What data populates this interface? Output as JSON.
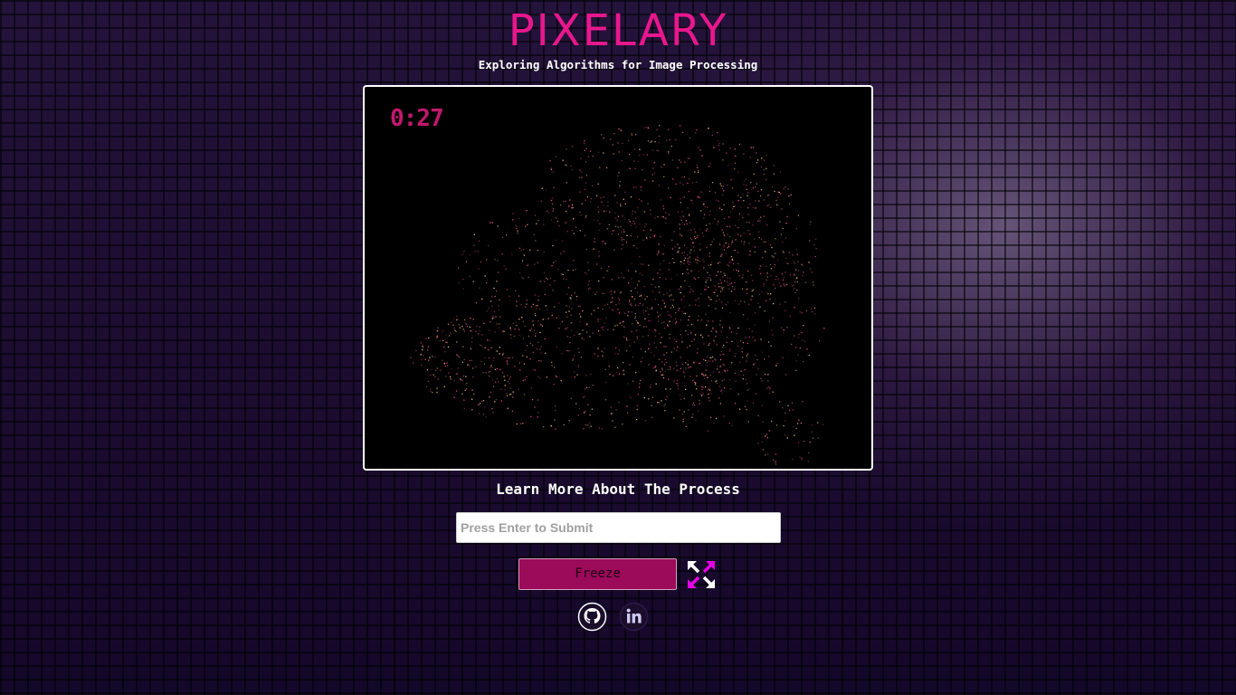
{
  "header": {
    "title": "PIXELARY",
    "subtitle": "Exploring Algorithms for Image Processing"
  },
  "canvas": {
    "timer": "0:27"
  },
  "learn_more": {
    "label": "Learn More About The Process"
  },
  "input": {
    "placeholder": "Press Enter to Submit",
    "value": ""
  },
  "controls": {
    "freeze_label": "Freeze",
    "expand_icon": "expand-arrows-icon"
  },
  "social": {
    "github_icon": "github-icon",
    "linkedin_icon": "linkedin-icon"
  },
  "colors": {
    "accent": "#e8178d",
    "button": "#9c0a5a",
    "expand_magenta": "#e600e6"
  }
}
